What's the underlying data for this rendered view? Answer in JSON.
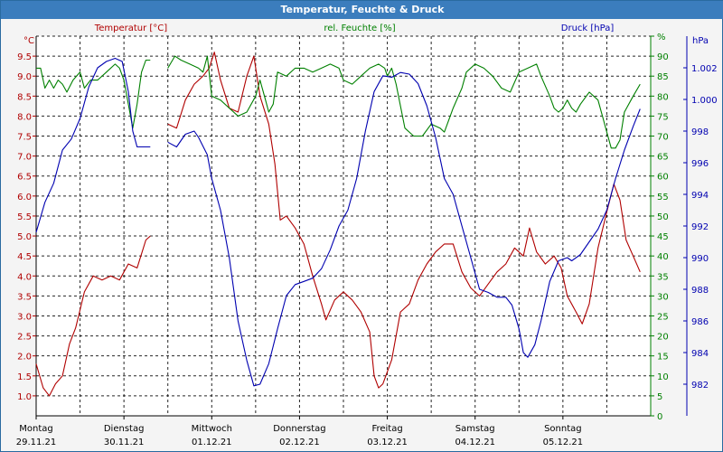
{
  "window": {
    "title": "Temperatur, Feuchte & Druck"
  },
  "chart_data": {
    "type": "line",
    "title": "Temperatur, Feuchte & Druck",
    "grid": true,
    "x": {
      "range": [
        0,
        7
      ],
      "tick_labels": [
        {
          "day": "Montag",
          "date": "29.11.21"
        },
        {
          "day": "Dienstag",
          "date": "30.11.21"
        },
        {
          "day": "Mittwoch",
          "date": "01.12.21"
        },
        {
          "day": "Donnerstag",
          "date": "02.12.21"
        },
        {
          "day": "Freitag",
          "date": "03.12.21"
        },
        {
          "day": "Samstag",
          "date": "04.12.21"
        },
        {
          "day": "Sonntag",
          "date": "05.12.21"
        }
      ]
    },
    "axes": {
      "temp": {
        "unit": "°C",
        "range": [
          0.5,
          10
        ],
        "ticks": [
          "1.0",
          "1.5",
          "2.0",
          "2.5",
          "3.0",
          "3.5",
          "4.0",
          "4.5",
          "5.0",
          "5.5",
          "6.0",
          "6.5",
          "7.0",
          "7.5",
          "8.0",
          "8.5",
          "9.0",
          "9.5"
        ],
        "color": "#b00000"
      },
      "hum": {
        "unit": "%",
        "range": [
          0,
          95
        ],
        "ticks": [
          "0",
          "5",
          "10",
          "15",
          "20",
          "25",
          "30",
          "35",
          "40",
          "45",
          "50",
          "55",
          "60",
          "65",
          "70",
          "75",
          "80",
          "85",
          "90",
          "95"
        ],
        "color": "#008000"
      },
      "press": {
        "unit": "hPa",
        "range": [
          980,
          1004
        ],
        "ticks": [
          "982",
          "984",
          "986",
          "988",
          "990",
          "992",
          "994",
          "996",
          "998",
          "1.000",
          "1.002"
        ],
        "color": "#0000b0"
      }
    },
    "series": [
      {
        "name": "Temperatur [°C]",
        "axis": "temp",
        "color": "#b00000",
        "segments": [
          [
            [
              0,
              1.8
            ],
            [
              0.08,
              1.2
            ],
            [
              0.15,
              1.0
            ],
            [
              0.22,
              1.3
            ],
            [
              0.3,
              1.5
            ],
            [
              0.38,
              2.3
            ],
            [
              0.45,
              2.7
            ],
            [
              0.55,
              3.6
            ],
            [
              0.65,
              4.0
            ],
            [
              0.75,
              3.9
            ],
            [
              0.85,
              4.0
            ],
            [
              0.95,
              3.9
            ],
            [
              1.05,
              4.3
            ],
            [
              1.15,
              4.2
            ],
            [
              1.25,
              4.9
            ],
            [
              1.3,
              5.0
            ]
          ],
          [
            [
              1.5,
              7.8
            ],
            [
              1.6,
              7.7
            ],
            [
              1.7,
              8.4
            ],
            [
              1.8,
              8.8
            ],
            [
              1.9,
              9.0
            ],
            [
              1.97,
              9.2
            ],
            [
              2.03,
              9.6
            ],
            [
              2.1,
              8.9
            ],
            [
              2.2,
              8.2
            ],
            [
              2.3,
              8.1
            ],
            [
              2.4,
              9.0
            ],
            [
              2.48,
              9.5
            ],
            [
              2.55,
              8.5
            ],
            [
              2.65,
              7.8
            ],
            [
              2.72,
              6.8
            ],
            [
              2.78,
              5.4
            ],
            [
              2.85,
              5.5
            ],
            [
              2.95,
              5.2
            ],
            [
              3.05,
              4.8
            ],
            [
              3.15,
              4.0
            ],
            [
              3.25,
              3.3
            ],
            [
              3.3,
              2.9
            ],
            [
              3.4,
              3.4
            ],
            [
              3.5,
              3.6
            ],
            [
              3.6,
              3.4
            ],
            [
              3.7,
              3.1
            ],
            [
              3.8,
              2.6
            ],
            [
              3.85,
              1.5
            ],
            [
              3.9,
              1.2
            ],
            [
              3.95,
              1.3
            ],
            [
              4.05,
              1.9
            ],
            [
              4.15,
              3.1
            ],
            [
              4.25,
              3.3
            ],
            [
              4.35,
              3.9
            ],
            [
              4.45,
              4.3
            ],
            [
              4.55,
              4.6
            ],
            [
              4.65,
              4.8
            ],
            [
              4.75,
              4.8
            ],
            [
              4.85,
              4.1
            ],
            [
              4.95,
              3.7
            ],
            [
              5.05,
              3.5
            ],
            [
              5.15,
              3.8
            ],
            [
              5.25,
              4.1
            ],
            [
              5.35,
              4.3
            ],
            [
              5.45,
              4.7
            ],
            [
              5.55,
              4.5
            ],
            [
              5.62,
              5.2
            ],
            [
              5.7,
              4.6
            ],
            [
              5.8,
              4.3
            ],
            [
              5.9,
              4.5
            ],
            [
              5.98,
              4.2
            ],
            [
              6.05,
              3.5
            ],
            [
              6.15,
              3.1
            ],
            [
              6.22,
              2.8
            ],
            [
              6.3,
              3.3
            ],
            [
              6.4,
              4.7
            ],
            [
              6.5,
              5.6
            ],
            [
              6.58,
              6.3
            ],
            [
              6.65,
              5.9
            ],
            [
              6.72,
              4.9
            ],
            [
              6.8,
              4.5
            ],
            [
              6.88,
              4.1
            ]
          ]
        ]
      },
      {
        "name": "rel. Feuchte [%]",
        "axis": "hum",
        "color": "#008000",
        "segments": [
          [
            [
              0,
              87
            ],
            [
              0.05,
              87
            ],
            [
              0.1,
              82
            ],
            [
              0.15,
              84
            ],
            [
              0.2,
              82
            ],
            [
              0.25,
              84
            ],
            [
              0.3,
              83
            ],
            [
              0.35,
              81
            ],
            [
              0.42,
              84
            ],
            [
              0.5,
              86
            ],
            [
              0.55,
              82
            ],
            [
              0.62,
              84
            ],
            [
              0.7,
              84
            ],
            [
              0.8,
              86
            ],
            [
              0.9,
              88
            ],
            [
              0.95,
              87
            ],
            [
              1.0,
              84
            ],
            [
              1.05,
              78
            ],
            [
              1.1,
              72
            ],
            [
              1.15,
              78
            ],
            [
              1.2,
              86
            ],
            [
              1.25,
              89
            ],
            [
              1.3,
              89
            ]
          ],
          [
            [
              1.5,
              87
            ],
            [
              1.58,
              90
            ],
            [
              1.65,
              89
            ],
            [
              1.75,
              88
            ],
            [
              1.85,
              87
            ],
            [
              1.9,
              86
            ],
            [
              1.95,
              90
            ],
            [
              2.0,
              80
            ],
            [
              2.1,
              79
            ],
            [
              2.2,
              77
            ],
            [
              2.3,
              75
            ],
            [
              2.4,
              76
            ],
            [
              2.5,
              80
            ],
            [
              2.55,
              84
            ],
            [
              2.6,
              80
            ],
            [
              2.65,
              76
            ],
            [
              2.7,
              78
            ],
            [
              2.75,
              86
            ],
            [
              2.85,
              85
            ],
            [
              2.95,
              87
            ],
            [
              3.05,
              87
            ],
            [
              3.15,
              86
            ],
            [
              3.25,
              87
            ],
            [
              3.35,
              88
            ],
            [
              3.45,
              87
            ],
            [
              3.5,
              84
            ],
            [
              3.6,
              83
            ],
            [
              3.7,
              85
            ],
            [
              3.8,
              87
            ],
            [
              3.9,
              88
            ],
            [
              3.97,
              87
            ],
            [
              4.0,
              85
            ],
            [
              4.05,
              87
            ],
            [
              4.1,
              83
            ],
            [
              4.2,
              72
            ],
            [
              4.3,
              70
            ],
            [
              4.4,
              70
            ],
            [
              4.5,
              73
            ],
            [
              4.6,
              72
            ],
            [
              4.65,
              71
            ],
            [
              4.75,
              77
            ],
            [
              4.85,
              82
            ],
            [
              4.9,
              86
            ],
            [
              5.0,
              88
            ],
            [
              5.1,
              87
            ],
            [
              5.2,
              85
            ],
            [
              5.3,
              82
            ],
            [
              5.4,
              81
            ],
            [
              5.5,
              86
            ],
            [
              5.6,
              87
            ],
            [
              5.7,
              88
            ],
            [
              5.75,
              85
            ],
            [
              5.85,
              80
            ],
            [
              5.9,
              77
            ],
            [
              5.95,
              76
            ],
            [
              6.0,
              77
            ],
            [
              6.05,
              79
            ],
            [
              6.1,
              77
            ],
            [
              6.15,
              76
            ],
            [
              6.2,
              78
            ],
            [
              6.3,
              81
            ],
            [
              6.4,
              79
            ],
            [
              6.45,
              75
            ],
            [
              6.5,
              71
            ],
            [
              6.55,
              67
            ],
            [
              6.6,
              67
            ],
            [
              6.65,
              69
            ],
            [
              6.7,
              76
            ],
            [
              6.8,
              80
            ],
            [
              6.88,
              83
            ]
          ]
        ]
      },
      {
        "name": "Druck [hPa]",
        "axis": "press",
        "color": "#0000b0",
        "segments": [
          [
            [
              0,
              991.6
            ],
            [
              0.1,
              993.5
            ],
            [
              0.2,
              994.7
            ],
            [
              0.3,
              996.8
            ],
            [
              0.4,
              997.5
            ],
            [
              0.5,
              998.8
            ],
            [
              0.6,
              1000.8
            ],
            [
              0.7,
              1002.0
            ],
            [
              0.8,
              1002.4
            ],
            [
              0.9,
              1002.6
            ],
            [
              0.98,
              1002.4
            ],
            [
              1.05,
              1000.5
            ],
            [
              1.1,
              998.0
            ],
            [
              1.15,
              997.0
            ],
            [
              1.25,
              997.0
            ],
            [
              1.3,
              997.0
            ]
          ],
          [
            [
              1.5,
              997.3
            ],
            [
              1.6,
              997.0
            ],
            [
              1.7,
              997.8
            ],
            [
              1.8,
              998.0
            ],
            [
              1.85,
              997.6
            ],
            [
              1.95,
              996.5
            ],
            [
              2.0,
              995.0
            ],
            [
              2.1,
              993.0
            ],
            [
              2.2,
              990.0
            ],
            [
              2.3,
              986.0
            ],
            [
              2.4,
              983.5
            ],
            [
              2.48,
              981.9
            ],
            [
              2.55,
              982.0
            ],
            [
              2.65,
              983.3
            ],
            [
              2.75,
              985.5
            ],
            [
              2.85,
              987.6
            ],
            [
              2.95,
              988.3
            ],
            [
              3.05,
              988.5
            ],
            [
              3.15,
              988.7
            ],
            [
              3.25,
              989.3
            ],
            [
              3.35,
              990.5
            ],
            [
              3.45,
              992.0
            ],
            [
              3.55,
              993.0
            ],
            [
              3.65,
              995.0
            ],
            [
              3.75,
              998.0
            ],
            [
              3.85,
              1000.5
            ],
            [
              3.95,
              1001.5
            ],
            [
              4.05,
              1001.4
            ],
            [
              4.15,
              1001.7
            ],
            [
              4.25,
              1001.6
            ],
            [
              4.35,
              1001.0
            ],
            [
              4.45,
              999.6
            ],
            [
              4.55,
              997.6
            ],
            [
              4.65,
              995.0
            ],
            [
              4.75,
              994.0
            ],
            [
              4.85,
              992.0
            ],
            [
              4.95,
              990.0
            ],
            [
              5.05,
              988.0
            ],
            [
              5.15,
              987.8
            ],
            [
              5.25,
              987.5
            ],
            [
              5.35,
              987.5
            ],
            [
              5.42,
              987.0
            ],
            [
              5.5,
              985.5
            ],
            [
              5.55,
              984.0
            ],
            [
              5.6,
              983.7
            ],
            [
              5.68,
              984.5
            ],
            [
              5.75,
              986.0
            ],
            [
              5.85,
              988.5
            ],
            [
              5.95,
              989.8
            ],
            [
              6.05,
              990.0
            ],
            [
              6.1,
              989.8
            ],
            [
              6.2,
              990.2
            ],
            [
              6.3,
              991.0
            ],
            [
              6.4,
              991.8
            ],
            [
              6.5,
              993.0
            ],
            [
              6.6,
              995.0
            ],
            [
              6.7,
              996.8
            ],
            [
              6.8,
              998.3
            ],
            [
              6.88,
              999.4
            ]
          ]
        ]
      }
    ]
  }
}
